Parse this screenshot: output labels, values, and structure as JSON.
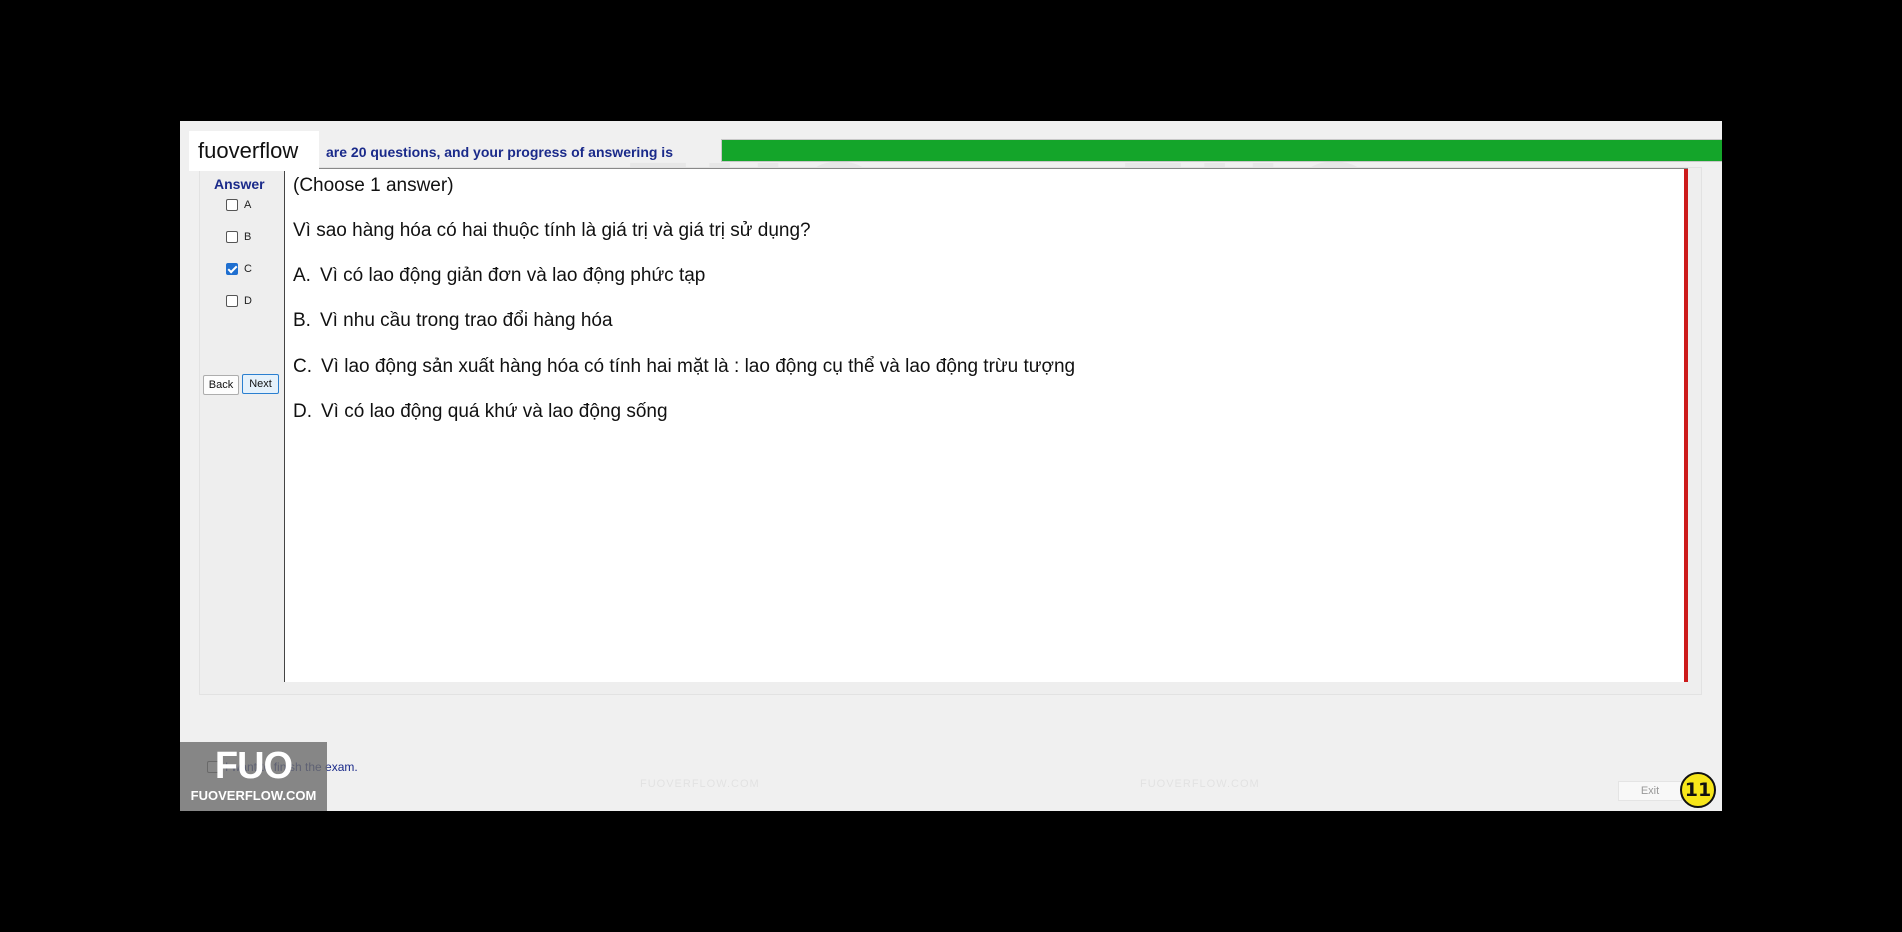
{
  "brand": "fuoverflow",
  "header": {
    "progress_text": "are 20 questions, and your progress of answering is",
    "progress": 1.0,
    "progress_color": "#14a52a"
  },
  "answer_panel": {
    "title": "Answer",
    "options": [
      {
        "label": "A",
        "checked": false
      },
      {
        "label": "B",
        "checked": false
      },
      {
        "label": "C",
        "checked": true
      },
      {
        "label": "D",
        "checked": false
      }
    ],
    "back_label": "Back",
    "next_label": "Next"
  },
  "question": {
    "instruction": "(Choose 1 answer)",
    "text": "Vì sao hàng hóa có hai thuộc tính là giá trị và giá trị sử dụng?",
    "choices": [
      {
        "letter": "A.",
        "text": "Vì có lao động giản đơn và lao động phức tạp"
      },
      {
        "letter": "B.",
        "text": "Vì nhu cầu trong trao đổi hàng hóa"
      },
      {
        "letter": "C.",
        "text": "Vì lao động sản xuất hàng hóa có tính hai mặt là : lao động cụ thể và lao động trừu tượng"
      },
      {
        "letter": "D.",
        "text": "Vì có lao động quá khứ và lao động sống"
      }
    ]
  },
  "footer": {
    "finish_text": "I want to finish the exam.",
    "exit_label": "Exit",
    "timer": "11",
    "logo_big": "FUO",
    "logo_small": "FUOVERFLOW.COM"
  },
  "watermark": {
    "big": "FUO",
    "small": "FUOVERFLOW.COM"
  }
}
